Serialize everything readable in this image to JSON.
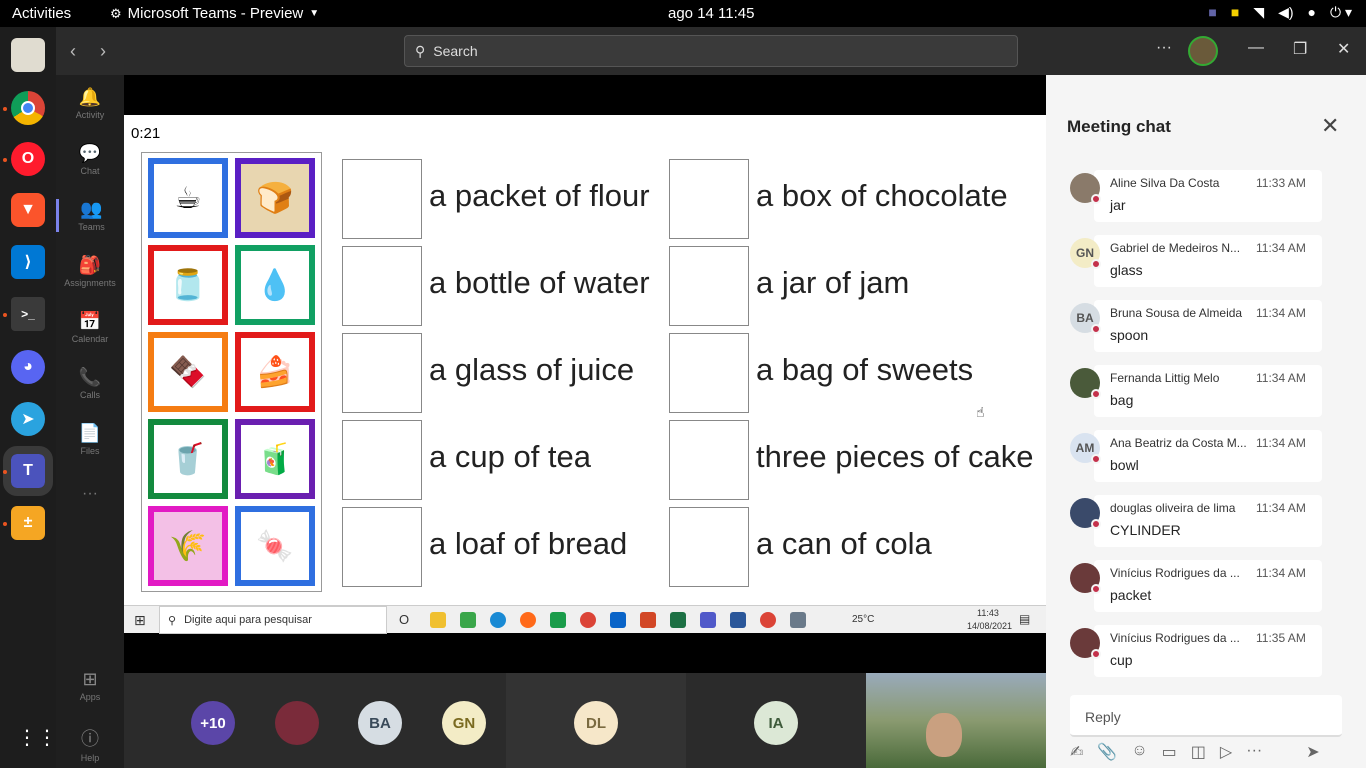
{
  "topbar": {
    "activities": "Activities",
    "app_name": "Microsoft Teams - Preview",
    "clock": "ago 14  11:45"
  },
  "titlebar": {
    "search_placeholder": "Search",
    "more": "···"
  },
  "rail": {
    "items": [
      {
        "label": "Activity",
        "icon": "bell-icon",
        "glyph": "🔔"
      },
      {
        "label": "Chat",
        "icon": "chat-icon",
        "glyph": "💬"
      },
      {
        "label": "Teams",
        "icon": "teams-icon",
        "glyph": "👥"
      },
      {
        "label": "Assignments",
        "icon": "assignments-icon",
        "glyph": "🎒"
      },
      {
        "label": "Calendar",
        "icon": "calendar-icon",
        "glyph": "📅"
      },
      {
        "label": "Calls",
        "icon": "calls-icon",
        "glyph": "📞"
      },
      {
        "label": "Files",
        "icon": "files-icon",
        "glyph": "📄"
      },
      {
        "label": "···",
        "icon": "more-icon",
        "glyph": ""
      },
      {
        "label": "Apps",
        "icon": "apps-icon",
        "glyph": "⊞"
      },
      {
        "label": "Help",
        "icon": "help-icon",
        "glyph": "?"
      }
    ]
  },
  "slide": {
    "timer": "0:21",
    "column1": [
      "a packet of flour",
      "a bottle of water",
      "a glass of juice",
      "a cup of tea",
      "a loaf of bread"
    ],
    "column2": [
      "a box of chocolate",
      "a jar of jam",
      "a bag of sweets",
      "three pieces of cake",
      "a can of cola"
    ]
  },
  "taskbar": {
    "search_placeholder": "Digite aqui para pesquisar",
    "weather": "25°C",
    "time": "11:43",
    "date": "14/08/2021"
  },
  "participants": [
    {
      "initials": "+10",
      "bg": "#5b46a8",
      "fg": "#fff"
    },
    {
      "initials": "",
      "bg": "#7a2b3a",
      "fg": "#fff"
    },
    {
      "initials": "BA",
      "bg": "#d6dde3",
      "fg": "#3a4a5a"
    },
    {
      "initials": "GN",
      "bg": "#f3ecc6",
      "fg": "#7a6a20"
    },
    {
      "initials": "DL",
      "bg": "#f6e7c9",
      "fg": "#7a6a40"
    },
    {
      "initials": "IA",
      "bg": "#dce8d6",
      "fg": "#3d5a3a"
    }
  ],
  "chat": {
    "title": "Meeting chat",
    "reply_placeholder": "Reply",
    "messages": [
      {
        "name": "Aline Silva Da Costa",
        "time": "11:33 AM",
        "text": "jar",
        "initials": "",
        "avbg": "#8a7a6a"
      },
      {
        "name": "Gabriel de Medeiros N...",
        "time": "11:34 AM",
        "text": "glass",
        "initials": "GN",
        "avbg": "#f3ecc6"
      },
      {
        "name": "Bruna Sousa de Almeida",
        "time": "11:34 AM",
        "text": "spoon",
        "initials": "BA",
        "avbg": "#d6dde3"
      },
      {
        "name": "Fernanda Littig Melo",
        "time": "11:34 AM",
        "text": "bag",
        "initials": "",
        "avbg": "#4a5a3a"
      },
      {
        "name": "Ana Beatriz da Costa M...",
        "time": "11:34 AM",
        "text": "bowl",
        "initials": "AM",
        "avbg": "#d9e3f0"
      },
      {
        "name": "douglas oliveira de lima",
        "time": "11:34 AM",
        "text": "CYLINDER",
        "initials": "",
        "avbg": "#3a4a6a"
      },
      {
        "name": "Vinícius Rodrigues da ...",
        "time": "11:34 AM",
        "text": "packet",
        "initials": "",
        "avbg": "#6a3a3a"
      },
      {
        "name": "Vinícius Rodrigues da ...",
        "time": "11:35 AM",
        "text": "cup",
        "initials": "",
        "avbg": "#6a3a3a"
      }
    ]
  }
}
